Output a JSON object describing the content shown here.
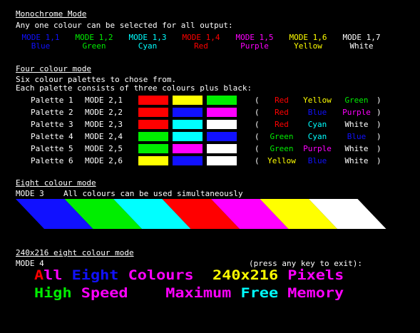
{
  "colors": {
    "blue": "#1111ff",
    "green": "#00ee00",
    "cyan": "#00ffff",
    "red": "#ff0000",
    "purple": "#ff00ff",
    "yellow": "#ffff00",
    "white": "#ffffff",
    "black": "#000000"
  },
  "monochrome": {
    "heading": "Monochrome Mode",
    "description": "Any one colour can be selected for all output:",
    "modes": [
      {
        "mode": "MODE 1,1",
        "name": "Blue",
        "color": "#1111ff"
      },
      {
        "mode": "MODE 1,2",
        "name": "Green",
        "color": "#00ee00"
      },
      {
        "mode": "MODE 1,3",
        "name": "Cyan",
        "color": "#00ffff"
      },
      {
        "mode": "MODE 1,4",
        "name": "Red",
        "color": "#ff0000"
      },
      {
        "mode": "MODE 1,5",
        "name": "Purple",
        "color": "#ff00ff"
      },
      {
        "mode": "MODE 1,6",
        "name": "Yellow",
        "color": "#ffff00"
      },
      {
        "mode": "MODE 1,7",
        "name": "White",
        "color": "#ffffff"
      }
    ]
  },
  "four_colour": {
    "heading": "Four colour mode",
    "line1": "Six colour palettes to chose from.",
    "line2": "Each palette consists of three colours plus black:",
    "open_paren": "(",
    "close_paren": ")",
    "palettes": [
      {
        "label": "Palette 1",
        "mode": "MODE 2,1",
        "swatches": [
          "#ff0000",
          "#ffff00",
          "#00ee00"
        ],
        "names": [
          {
            "text": "Red",
            "color": "#ff0000"
          },
          {
            "text": "Yellow",
            "color": "#ffff00"
          },
          {
            "text": "Green",
            "color": "#00ee00"
          }
        ]
      },
      {
        "label": "Palette 2",
        "mode": "MODE 2,2",
        "swatches": [
          "#ff0000",
          "#1111ff",
          "#ff00ff"
        ],
        "names": [
          {
            "text": "Red",
            "color": "#ff0000"
          },
          {
            "text": "Blue",
            "color": "#1111ff"
          },
          {
            "text": "Purple",
            "color": "#ff00ff"
          }
        ]
      },
      {
        "label": "Palette 3",
        "mode": "MODE 2,3",
        "swatches": [
          "#ff0000",
          "#00ffff",
          "#ffffff"
        ],
        "names": [
          {
            "text": "Red",
            "color": "#ff0000"
          },
          {
            "text": "Cyan",
            "color": "#00ffff"
          },
          {
            "text": "White",
            "color": "#ffffff"
          }
        ]
      },
      {
        "label": "Palette 4",
        "mode": "MODE 2,4",
        "swatches": [
          "#00ee00",
          "#00ffff",
          "#1111ff"
        ],
        "names": [
          {
            "text": "Green",
            "color": "#00ee00"
          },
          {
            "text": "Cyan",
            "color": "#00ffff"
          },
          {
            "text": "Blue",
            "color": "#1111ff"
          }
        ]
      },
      {
        "label": "Palette 5",
        "mode": "MODE 2,5",
        "swatches": [
          "#00ee00",
          "#ff00ff",
          "#ffffff"
        ],
        "names": [
          {
            "text": "Green",
            "color": "#00ee00"
          },
          {
            "text": "Purple",
            "color": "#ff00ff"
          },
          {
            "text": "White",
            "color": "#ffffff"
          }
        ]
      },
      {
        "label": "Palette 6",
        "mode": "MODE 2,6",
        "swatches": [
          "#ffff00",
          "#1111ff",
          "#ffffff"
        ],
        "names": [
          {
            "text": "Yellow",
            "color": "#ffff00"
          },
          {
            "text": "Blue",
            "color": "#1111ff"
          },
          {
            "text": "White",
            "color": "#ffffff"
          }
        ]
      }
    ]
  },
  "eight_colour": {
    "heading": "Eight colour mode",
    "mode": "MODE 3",
    "description": "All colours can be used simultaneously",
    "stripe_colors": [
      "#1111ff",
      "#00ee00",
      "#00ffff",
      "#ff0000",
      "#ff00ff",
      "#ffff00",
      "#ffffff"
    ]
  },
  "hires": {
    "heading": "240x216 eight colour mode",
    "mode": "MODE 4",
    "exit_prompt": "(press any key to exit):",
    "line1": [
      {
        "text": "A",
        "color": "#ff0000"
      },
      {
        "text": "ll",
        "color": "#ff00ff"
      },
      {
        "text": " "
      },
      {
        "text": "Eight",
        "color": "#1111ff"
      },
      {
        "text": " "
      },
      {
        "text": "Colours",
        "color": "#ff00ff"
      },
      {
        "text": "  "
      },
      {
        "text": "240x216",
        "color": "#ffff00"
      },
      {
        "text": " "
      },
      {
        "text": "Pixels",
        "color": "#ff00ff"
      }
    ],
    "line2": [
      {
        "text": "High",
        "color": "#00ee00"
      },
      {
        "text": " "
      },
      {
        "text": "Speed",
        "color": "#ff00ff"
      },
      {
        "text": "    "
      },
      {
        "text": "Maximum",
        "color": "#ff00ff"
      },
      {
        "text": " "
      },
      {
        "text": "Free",
        "color": "#00ffff"
      },
      {
        "text": " "
      },
      {
        "text": "Memory",
        "color": "#ff00ff"
      }
    ]
  }
}
